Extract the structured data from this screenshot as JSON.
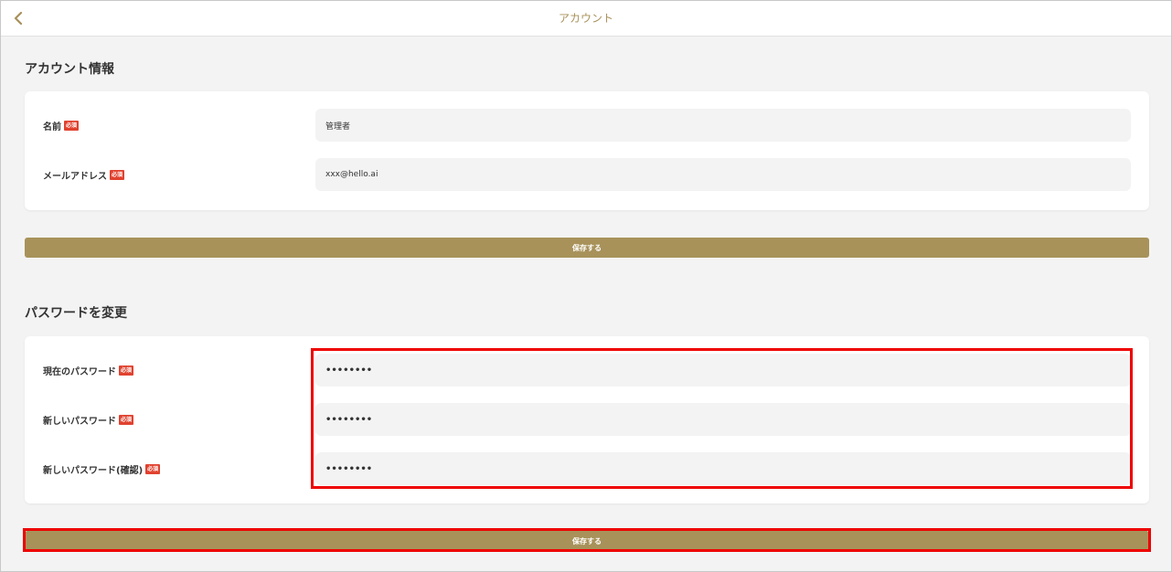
{
  "header": {
    "title": "アカウント",
    "back_icon": "chevron-left-icon"
  },
  "account_info": {
    "title": "アカウント情報",
    "fields": [
      {
        "label": "名前",
        "required": "必須",
        "value": "管理者"
      },
      {
        "label": "メールアドレス",
        "required": "必須",
        "value": "xxx@hello.ai"
      }
    ],
    "save_label": "保存する"
  },
  "password": {
    "title": "パスワードを変更",
    "fields": [
      {
        "label": "現在のパスワード",
        "required": "必須",
        "value": "••••••••"
      },
      {
        "label": "新しいパスワード",
        "required": "必須",
        "value": "••••••••"
      },
      {
        "label": "新しいパスワード(確認)",
        "required": "必須",
        "value": "••••••••"
      }
    ],
    "save_label": "保存する"
  },
  "colors": {
    "accent": "#a8925a",
    "required_badge": "#e0422f",
    "highlight": "#ee0000",
    "background": "#f3f3f3"
  }
}
